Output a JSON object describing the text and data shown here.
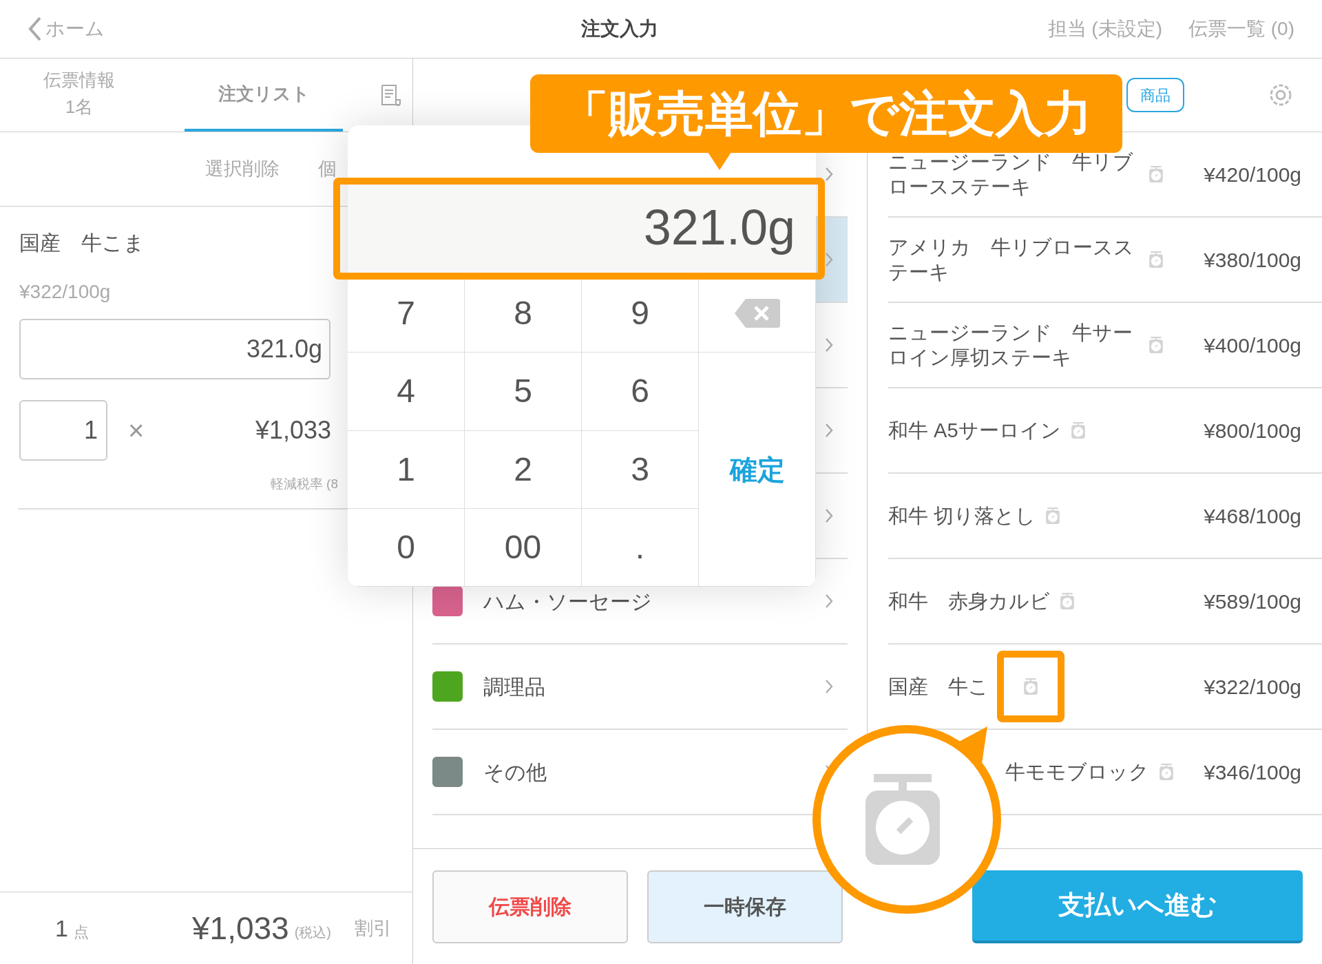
{
  "header": {
    "back": "ホーム",
    "title": "注文入力",
    "staff": "担当 (未設定)",
    "slips": "伝票一覧 (0)"
  },
  "left_tabs": [
    {
      "label": "伝票情報",
      "sub": "1名",
      "selected": false
    },
    {
      "label": "注文リスト",
      "selected": true
    }
  ],
  "left_actions": [
    "選択削除",
    "個"
  ],
  "order_item": {
    "name": "国産　牛こま",
    "unit_price": "¥322/100g",
    "weight": "321.0g",
    "qty": "1",
    "times": "×",
    "amount": "¥1,033",
    "tax": "軽減税率 (8"
  },
  "footer": {
    "count": "1",
    "count_unit": "点",
    "total": "¥1,033",
    "tax_note": "(税込)",
    "discount": "割引"
  },
  "toolbar": {
    "pill": "商品"
  },
  "categories": [
    {
      "selected": false
    },
    {
      "selected": true
    },
    {
      "selected": false
    },
    {
      "selected": false
    },
    {
      "selected": false
    },
    {
      "name": "ハム・ソーセージ",
      "color": "#d9638e",
      "selected": false
    },
    {
      "name": "調理品",
      "color": "#4ea620",
      "selected": false
    },
    {
      "name": "その他",
      "color": "#7b8987",
      "selected": false
    }
  ],
  "products": [
    {
      "kind": "full",
      "name": "ニュージーランド　牛リブロースステーキ",
      "price": "¥420/100g"
    },
    {
      "kind": "full",
      "name": "アメリカ　牛リブロースステーキ",
      "price": "¥380/100g"
    },
    {
      "kind": "full",
      "name": "ニュージーランド　牛サーロイン厚切ステーキ",
      "price": "¥400/100g"
    },
    {
      "kind": "full",
      "name": "和牛 A5サーロイン",
      "price": "¥800/100g"
    },
    {
      "kind": "full",
      "name": "和牛 切り落とし",
      "price": "¥468/100g"
    },
    {
      "kind": "full",
      "name": "和牛　赤身カルビ",
      "price": "¥589/100g"
    },
    {
      "kind": "marked",
      "name": "国産　牛こ",
      "price": "¥322/100g"
    },
    {
      "kind": "clipped",
      "name": "牛モモブロック",
      "price": "¥346/100g"
    }
  ],
  "buttons": {
    "delete": "伝票削除",
    "hold": "一時保存",
    "pay": "支払いへ進む"
  },
  "keypad": {
    "display": "321.0g",
    "keys": [
      {
        "kind": "digit",
        "label": "7"
      },
      {
        "kind": "digit",
        "label": "8"
      },
      {
        "kind": "digit",
        "label": "9"
      },
      {
        "kind": "backspace"
      },
      {
        "kind": "digit",
        "label": "4"
      },
      {
        "kind": "digit",
        "label": "5"
      },
      {
        "kind": "digit",
        "label": "6"
      },
      {
        "kind": "digit",
        "label": "1"
      },
      {
        "kind": "digit",
        "label": "2"
      },
      {
        "kind": "digit",
        "label": "3"
      },
      {
        "kind": "confirm",
        "label": "確定"
      },
      {
        "kind": "digit",
        "label": "0"
      },
      {
        "kind": "digit",
        "label": "00"
      },
      {
        "kind": "digit",
        "label": "."
      }
    ]
  },
  "annotation": {
    "callout": "「販売単位」で注文入力"
  }
}
